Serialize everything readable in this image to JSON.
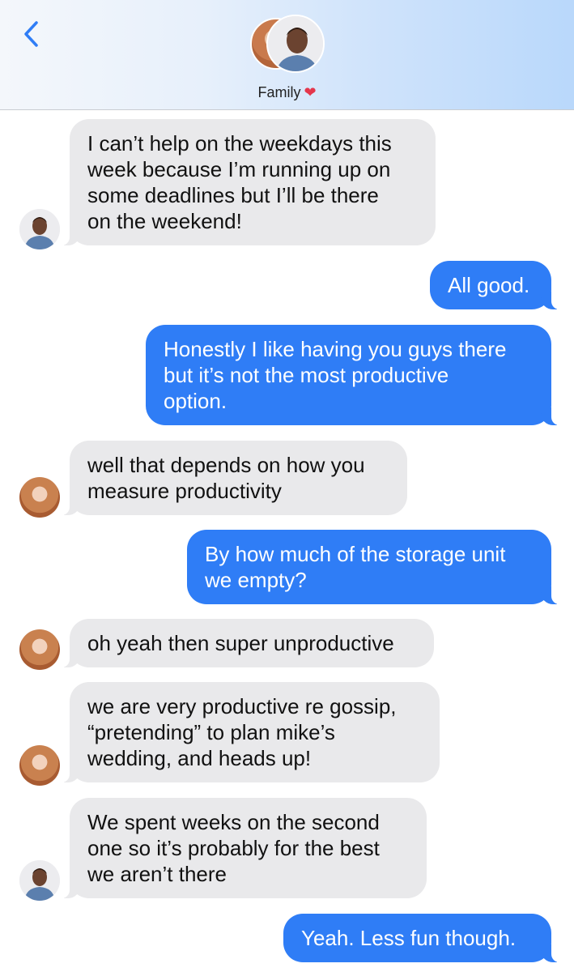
{
  "header": {
    "title": "Family",
    "heart_icon": "heart-icon",
    "back_icon": "chevron-left-icon",
    "accent": "#2f7df6"
  },
  "messages": [
    {
      "side": "in",
      "sender": "male",
      "text": "I can’t help on the weekdays this\nweek because I’m running up on\nsome deadlines but I’ll be there\non the weekend!"
    },
    {
      "side": "out",
      "text": "All good."
    },
    {
      "side": "out",
      "text": "Honestly I like having you guys there\nbut it’s not the most productive\noption."
    },
    {
      "side": "in",
      "sender": "female",
      "text": "well that depends on how you\nmeasure productivity"
    },
    {
      "side": "out",
      "text": "By how much of the storage unit\nwe empty?"
    },
    {
      "side": "in",
      "sender": "female",
      "text": "oh yeah then super unproductive"
    },
    {
      "side": "in",
      "sender": "female",
      "text": "we are very productive re gossip,\n“pretending” to plan mike’s\nwedding, and heads up!"
    },
    {
      "side": "in",
      "sender": "male",
      "text": "We spent weeks on the second\none so it’s probably for the best\nwe aren’t there"
    },
    {
      "side": "out",
      "text": "Yeah. Less fun though."
    }
  ],
  "colors": {
    "incoming_bubble": "#e9e9eb",
    "outgoing_bubble": "#2f7df6"
  }
}
